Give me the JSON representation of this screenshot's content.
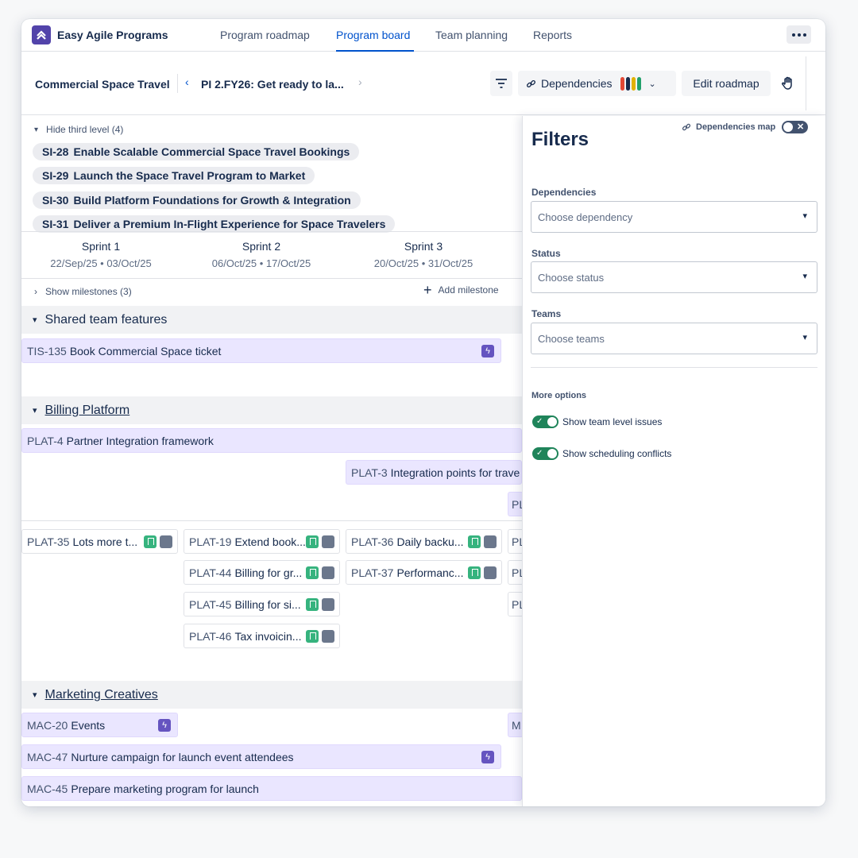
{
  "app": {
    "title": "Easy Agile Programs"
  },
  "nav": {
    "tabs": [
      {
        "label": "Program roadmap"
      },
      {
        "label": "Program board"
      },
      {
        "label": "Team planning"
      },
      {
        "label": "Reports"
      }
    ],
    "active_tab": "Program board"
  },
  "toolbar": {
    "program_name": "Commercial Space Travel",
    "pi_label": "PI 2.FY26: Get ready to la...",
    "dependencies_label": "Dependencies",
    "dependency_colors": [
      "#e34935",
      "#172b4d",
      "#e2b203",
      "#22a06b"
    ],
    "edit_roadmap_label": "Edit roadmap"
  },
  "board": {
    "third_level_toggle": "Hide third level (4)",
    "strategic_items": [
      {
        "key": "SI-28",
        "title": "Enable Scalable Commercial Space Travel Bookings"
      },
      {
        "key": "SI-29",
        "title": "Launch the Space Travel Program to Market"
      },
      {
        "key": "SI-30",
        "title": "Build Platform Foundations for Growth & Integration"
      },
      {
        "key": "SI-31",
        "title": "Deliver a Premium In-Flight Experience for Space Travelers"
      }
    ],
    "sprints": [
      {
        "name": "Sprint 1",
        "dates": "22/Sep/25 • 03/Oct/25"
      },
      {
        "name": "Sprint 2",
        "dates": "06/Oct/25 • 17/Oct/25"
      },
      {
        "name": "Sprint 3",
        "dates": "20/Oct/25 • 31/Oct/25"
      }
    ],
    "milestones_toggle": "Show milestones (3)",
    "add_milestone": "Add milestone",
    "teams": {
      "shared": {
        "name": "Shared team features",
        "features": [
          {
            "key": "TIS-135",
            "title": "Book Commercial Space ticket"
          }
        ]
      },
      "billing": {
        "name": "Billing Platform",
        "features": [
          {
            "key": "PLAT-4",
            "title": "Partner Integration framework"
          },
          {
            "key": "PLAT-3",
            "title": "Integration points for trave"
          }
        ],
        "stories": [
          {
            "key": "PLAT-35",
            "title": "Lots more t..."
          },
          {
            "key": "PLAT-19",
            "title": "Extend book..."
          },
          {
            "key": "PLAT-36",
            "title": "Daily backu..."
          },
          {
            "key": "PLAT-44",
            "title": "Billing for gr..."
          },
          {
            "key": "PLAT-37",
            "title": "Performanc..."
          },
          {
            "key": "PLAT-45",
            "title": "Billing for si..."
          },
          {
            "key": "PLAT-46",
            "title": "Tax invoicin..."
          }
        ],
        "clipped": [
          "PL",
          "PL",
          "PL",
          "PL"
        ]
      },
      "marketing": {
        "name": "Marketing Creatives",
        "features": [
          {
            "key": "MAC-20",
            "title": "Events"
          },
          {
            "key": "MAC-47",
            "title": "Nurture campaign for launch event attendees"
          },
          {
            "key": "MAC-45",
            "title": "Prepare marketing program for launch"
          }
        ],
        "clipped": [
          "M"
        ]
      }
    }
  },
  "filters": {
    "title": "Filters",
    "dependencies_map_label": "Dependencies map",
    "dependencies_map_on": false,
    "fields": [
      {
        "label": "Dependencies",
        "placeholder": "Choose dependency"
      },
      {
        "label": "Status",
        "placeholder": "Choose status"
      },
      {
        "label": "Teams",
        "placeholder": "Choose teams"
      }
    ],
    "more_options_label": "More options",
    "options": [
      {
        "label": "Show team level issues",
        "on": true
      },
      {
        "label": "Show scheduling conflicts",
        "on": true
      }
    ]
  }
}
